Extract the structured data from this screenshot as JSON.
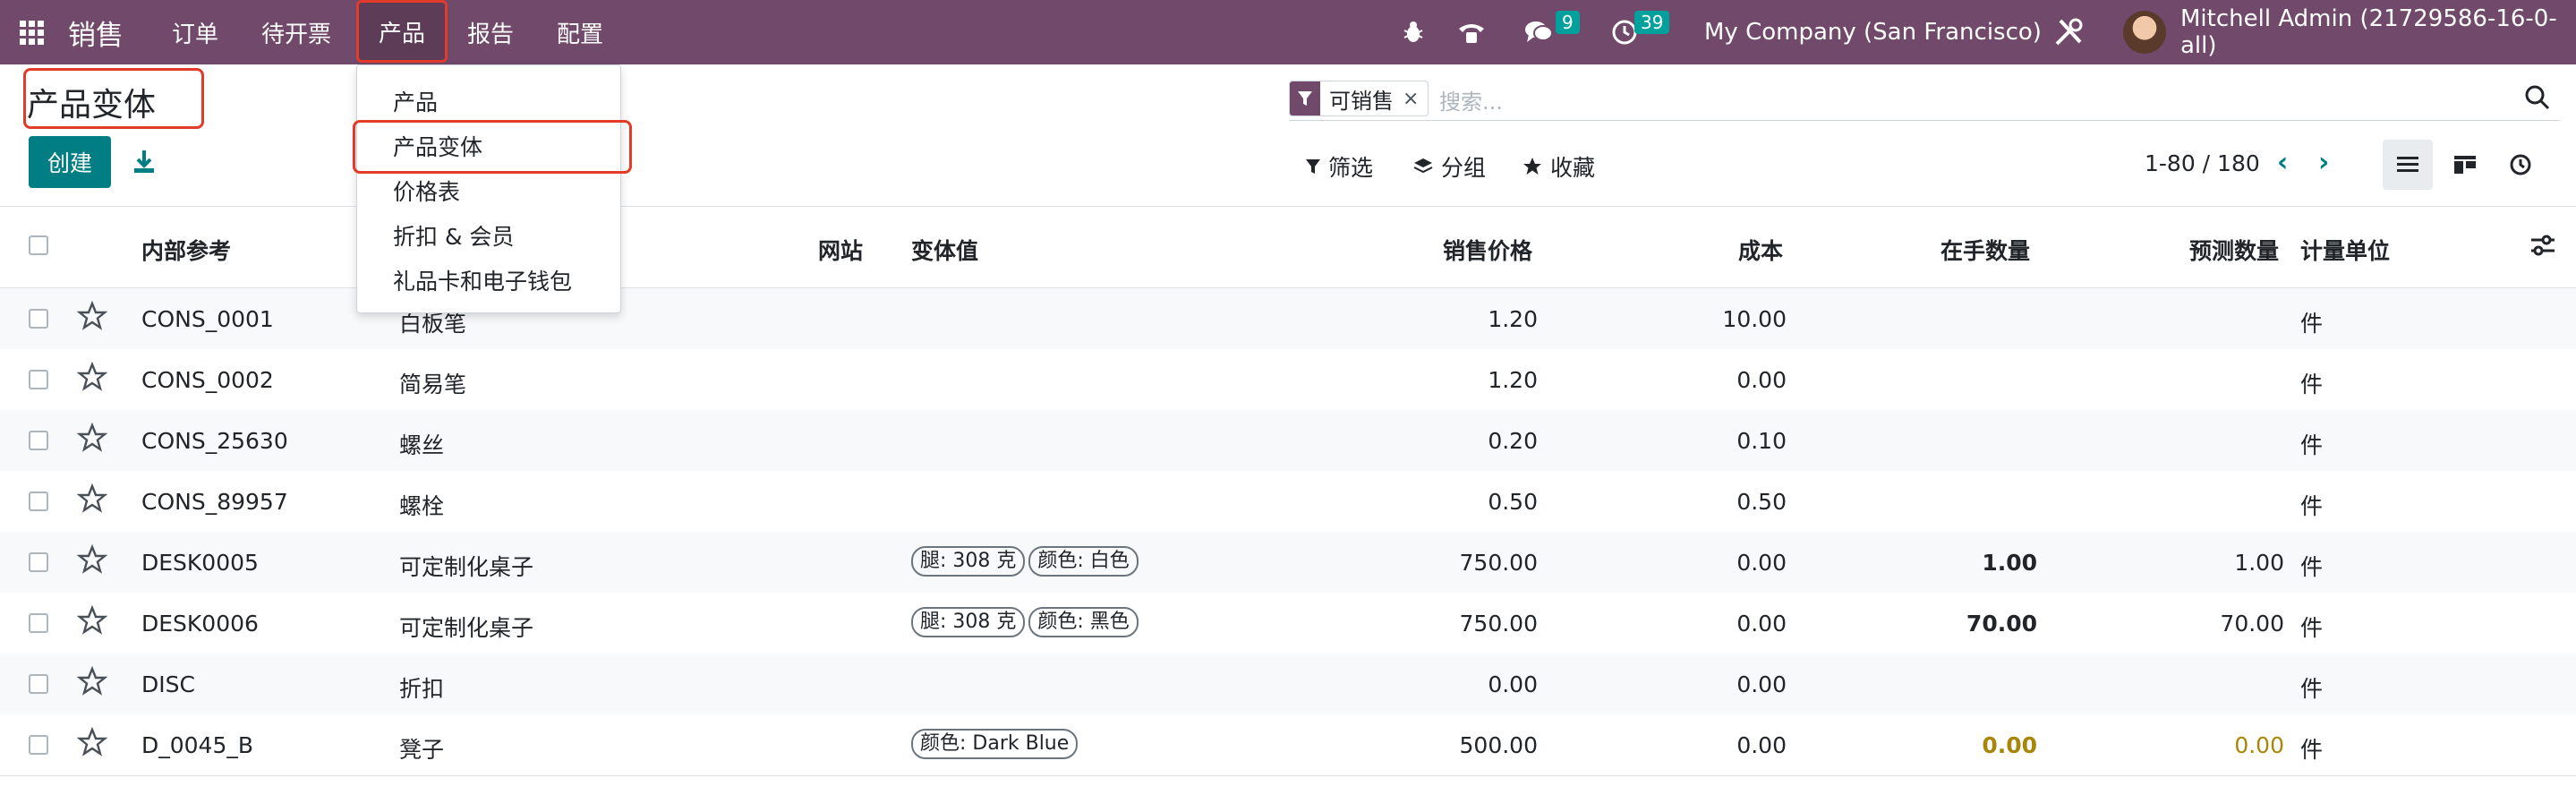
{
  "navbar": {
    "brand": "销售",
    "menu": [
      "订单",
      "待开票",
      "产品",
      "报告",
      "配置"
    ],
    "messages_count": "9",
    "activities_count": "39",
    "company": "My Company (San Francisco)",
    "user": "Mitchell Admin (21729586-16-0-all)"
  },
  "dropdown": {
    "items": [
      "产品",
      "产品变体",
      "价格表",
      "折扣 & 会员",
      "礼品卡和电子钱包"
    ]
  },
  "control": {
    "title": "产品变体",
    "create_label": "创建",
    "facet_label": "可销售",
    "search_placeholder": "搜索...",
    "filter_label": "筛选",
    "group_label": "分组",
    "favorite_label": "收藏",
    "pager": "1-80 / 180"
  },
  "table": {
    "headers": {
      "ref": "内部参考",
      "website": "网站",
      "variant_values": "变体值",
      "price": "销售价格",
      "cost": "成本",
      "onhand": "在手数量",
      "forecast": "预测数量",
      "uom": "计量单位"
    },
    "rows": [
      {
        "ref": "CONS_0001",
        "name": "白板笔",
        "tags": [],
        "price": "1.20",
        "cost": "10.00",
        "onhand": "",
        "forecast": "",
        "uom": "件"
      },
      {
        "ref": "CONS_0002",
        "name": "简易笔",
        "tags": [],
        "price": "1.20",
        "cost": "0.00",
        "onhand": "",
        "forecast": "",
        "uom": "件"
      },
      {
        "ref": "CONS_25630",
        "name": "螺丝",
        "tags": [],
        "price": "0.20",
        "cost": "0.10",
        "onhand": "",
        "forecast": "",
        "uom": "件"
      },
      {
        "ref": "CONS_89957",
        "name": "螺栓",
        "tags": [],
        "price": "0.50",
        "cost": "0.50",
        "onhand": "",
        "forecast": "",
        "uom": "件"
      },
      {
        "ref": "DESK0005",
        "name": "可定制化桌子",
        "tags": [
          "腿: 308 克",
          "颜色: 白色"
        ],
        "price": "750.00",
        "cost": "0.00",
        "onhand": "1.00",
        "forecast": "1.00",
        "uom": "件"
      },
      {
        "ref": "DESK0006",
        "name": "可定制化桌子",
        "tags": [
          "腿: 308 克",
          "颜色: 黑色"
        ],
        "price": "750.00",
        "cost": "0.00",
        "onhand": "70.00",
        "forecast": "70.00",
        "uom": "件"
      },
      {
        "ref": "DISC",
        "name": "折扣",
        "tags": [],
        "price": "0.00",
        "cost": "0.00",
        "onhand": "",
        "forecast": "",
        "uom": "件"
      },
      {
        "ref": "D_0045_B",
        "name": "凳子",
        "tags": [
          "颜色: Dark Blue"
        ],
        "price": "500.00",
        "cost": "0.00",
        "onhand": "0.00",
        "forecast": "0.00",
        "uom": "件",
        "warn": true
      }
    ]
  }
}
